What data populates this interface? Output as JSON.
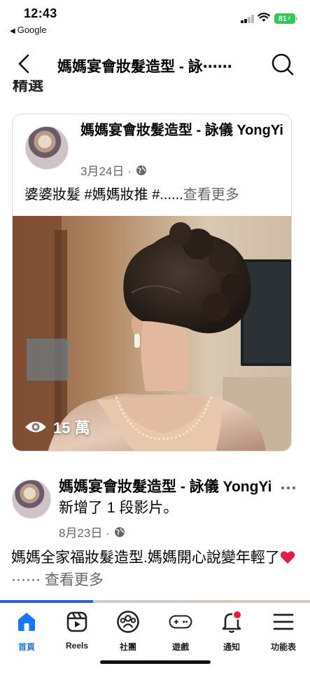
{
  "status_bar": {
    "time": "12:43",
    "back_app": "Google",
    "battery": "81"
  },
  "header": {
    "title": "媽媽宴會妝髮造型 - 詠⋯⋯",
    "section_peek": "精選"
  },
  "post1": {
    "author": "媽媽宴會妝髮造型 - 詠儀 YongYi",
    "date": "3月24日 ·",
    "text": "婆婆妝髮 #媽媽妝推 #......",
    "see_more": "查看更多",
    "views": "15 萬"
  },
  "post2": {
    "author": "媽媽宴會妝髮造型 - 詠儀 YongYi",
    "action": " 新增了 1 段影片。",
    "date": "8月23日 ·",
    "text": "媽媽全家福妝髮造型.媽媽開心說變年輕了",
    "see_more": "⋯⋯ 查看更多"
  },
  "tabs": [
    {
      "label": "首頁",
      "icon": "home-icon",
      "active": true
    },
    {
      "label": "Reels",
      "icon": "reels-icon",
      "active": false
    },
    {
      "label": "社團",
      "icon": "groups-icon",
      "active": false
    },
    {
      "label": "遊戲",
      "icon": "gaming-icon",
      "active": false
    },
    {
      "label": "通知",
      "icon": "bell-icon",
      "active": false
    },
    {
      "label": "功能表",
      "icon": "menu-icon",
      "active": false
    }
  ],
  "colors": {
    "accent": "#1877f2",
    "secondary_text": "#65676b",
    "notification_dot": "#e41e3f",
    "battery": "#34c759"
  }
}
